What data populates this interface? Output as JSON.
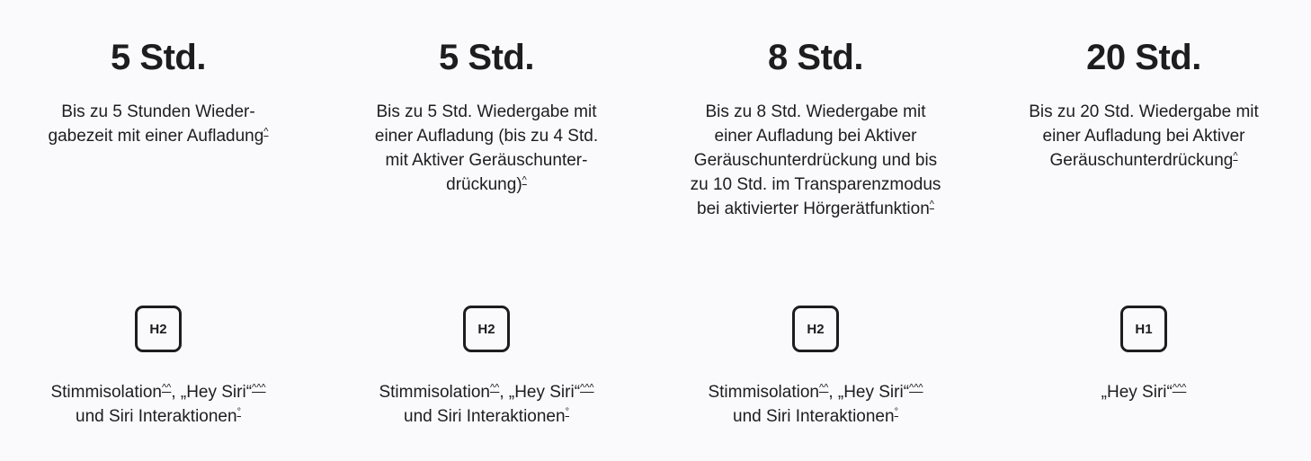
{
  "columns": [
    {
      "hours": "5 Std.",
      "desc_lines": [
        "Bis zu 5 Stunden Wieder-",
        "gabezeit mit einer Aufladung"
      ],
      "desc_fn": "^",
      "chip": "H2",
      "feature_a": "Stimmisolation",
      "feature_a_fn": "^^",
      "feature_b": ", „Hey Siri“",
      "feature_b_fn": "^^^",
      "feature_c": "und Siri Interaktionen",
      "feature_c_fn": "°"
    },
    {
      "hours": "5 Std.",
      "desc_lines": [
        "Bis zu 5 Std. Wiedergabe mit",
        "einer Aufladung (bis zu 4 Std.",
        "mit Aktiver Geräuschunter-",
        "drückung)"
      ],
      "desc_fn": "^",
      "chip": "H2",
      "feature_a": "Stimmisolation",
      "feature_a_fn": "^^",
      "feature_b": ", „Hey Siri“",
      "feature_b_fn": "^^^",
      "feature_c": "und Siri Interaktionen",
      "feature_c_fn": "°"
    },
    {
      "hours": "8 Std.",
      "desc_lines": [
        "Bis zu 8 Std. Wiedergabe mit",
        "einer Aufladung bei Aktiver",
        "Geräuschunterdrückung und bis",
        "zu 10 Std. im Transparenzmodus",
        "bei aktivierter Hörgerätfunktion"
      ],
      "desc_fn": "^",
      "chip": "H2",
      "feature_a": "Stimmisolation",
      "feature_a_fn": "^^",
      "feature_b": ", „Hey Siri“",
      "feature_b_fn": "^^^",
      "feature_c": "und Siri Interaktionen",
      "feature_c_fn": "°"
    },
    {
      "hours": "20 Std.",
      "desc_lines": [
        "Bis zu 20 Std. Wiedergabe mit",
        "einer Aufladung bei Aktiver",
        "Geräuschunterdrückung"
      ],
      "desc_fn": "^",
      "chip": "H1",
      "feature_b": "„Hey Siri“",
      "feature_b_fn": "^^^"
    }
  ],
  "icons": {
    "chip": "chip-icon"
  },
  "colors": {
    "text": "#1d1d1f",
    "background": "#fafafc"
  }
}
